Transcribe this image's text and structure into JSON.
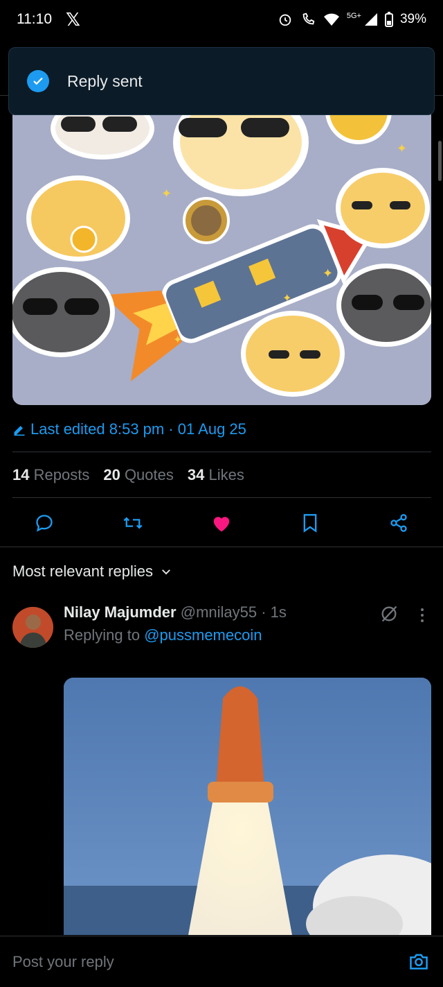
{
  "status_bar": {
    "time": "11:10",
    "network": "5G+",
    "battery": "39%"
  },
  "toast": {
    "text": "Reply sent"
  },
  "post": {
    "edited": "Last edited 8:53 pm · 01 Aug 25",
    "stats": {
      "reposts_count": "14",
      "reposts_label": "Reposts",
      "quotes_count": "20",
      "quotes_label": "Quotes",
      "likes_count": "34",
      "likes_label": "Likes"
    }
  },
  "actions": [
    "reply-icon",
    "repost-icon",
    "like-icon",
    "bookmark-icon",
    "share-icon"
  ],
  "colors": {
    "accent": "#1d9bf0",
    "like": "#f91880",
    "background": "#000000",
    "toast_bg": "#0b1b27"
  },
  "replies": {
    "sort_label": "Most relevant replies",
    "items": [
      {
        "name": "Nilay Majumder",
        "handle": "@mnilay55 · 1s",
        "replying_prefix": "Replying to ",
        "replying_to": "@pussmemecoin"
      }
    ]
  },
  "composer": {
    "placeholder": "Post your reply"
  }
}
